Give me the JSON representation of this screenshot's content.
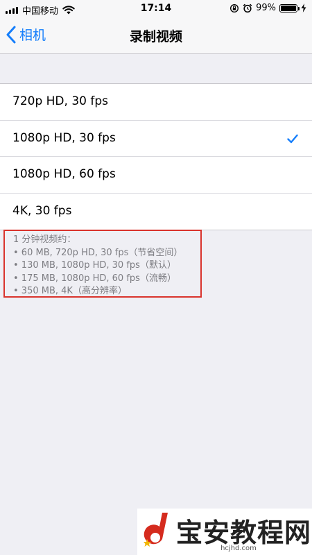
{
  "status": {
    "carrier": "中国移动",
    "time": "17:14",
    "battery": "99%",
    "battery_level": 0.99
  },
  "nav": {
    "back_label": "相机",
    "title": "录制视频"
  },
  "options": [
    {
      "label": "720p HD, 30 fps",
      "selected": false
    },
    {
      "label": "1080p HD, 30 fps",
      "selected": true
    },
    {
      "label": "1080p HD, 60 fps",
      "selected": false
    },
    {
      "label": "4K, 30 fps",
      "selected": false
    }
  ],
  "footer": {
    "lines": [
      "1 分钟视频约：",
      "• 60 MB, 720p HD, 30 fps（节省空间）",
      "• 130 MB, 1080p HD, 30 fps（默认）",
      "• 175 MB, 1080p HD, 60 fps（流畅）",
      "• 350 MB, 4K（高分辨率）"
    ]
  },
  "watermark": {
    "text": "宝安教程网",
    "url": "hcjhd.com"
  },
  "colors": {
    "accent": "#157efb",
    "highlight_border": "#d9332c"
  }
}
